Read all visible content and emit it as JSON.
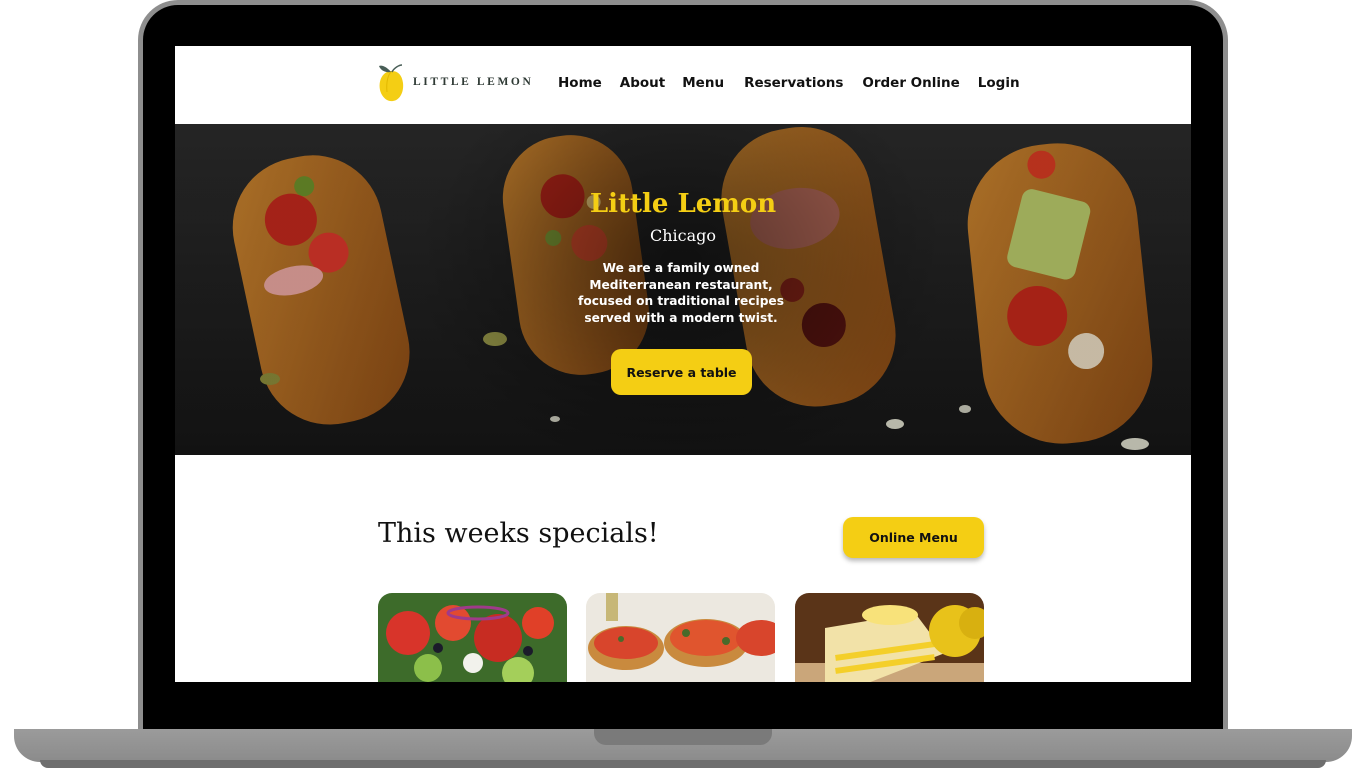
{
  "brand": {
    "logo_text": "LITTLE LEMON",
    "logo_icon": "lemon-icon",
    "accent_color": "#f4ce14"
  },
  "nav": {
    "items": [
      {
        "label": "Home"
      },
      {
        "label": "About"
      },
      {
        "label": "Menu"
      },
      {
        "label": "Reservations"
      },
      {
        "label": "Order Online"
      },
      {
        "label": "Login"
      }
    ]
  },
  "hero": {
    "title": "Little Lemon",
    "subtitle": "Chicago",
    "description": "We are a family owned Mediterranean restaurant, focused on traditional recipes served with a modern twist.",
    "cta_label": "Reserve a table"
  },
  "specials": {
    "title": "This weeks specials!",
    "menu_button_label": "Online Menu",
    "cards": [
      {
        "image": "greek-salad-image"
      },
      {
        "image": "bruschetta-image"
      },
      {
        "image": "lemon-dessert-image"
      }
    ]
  }
}
